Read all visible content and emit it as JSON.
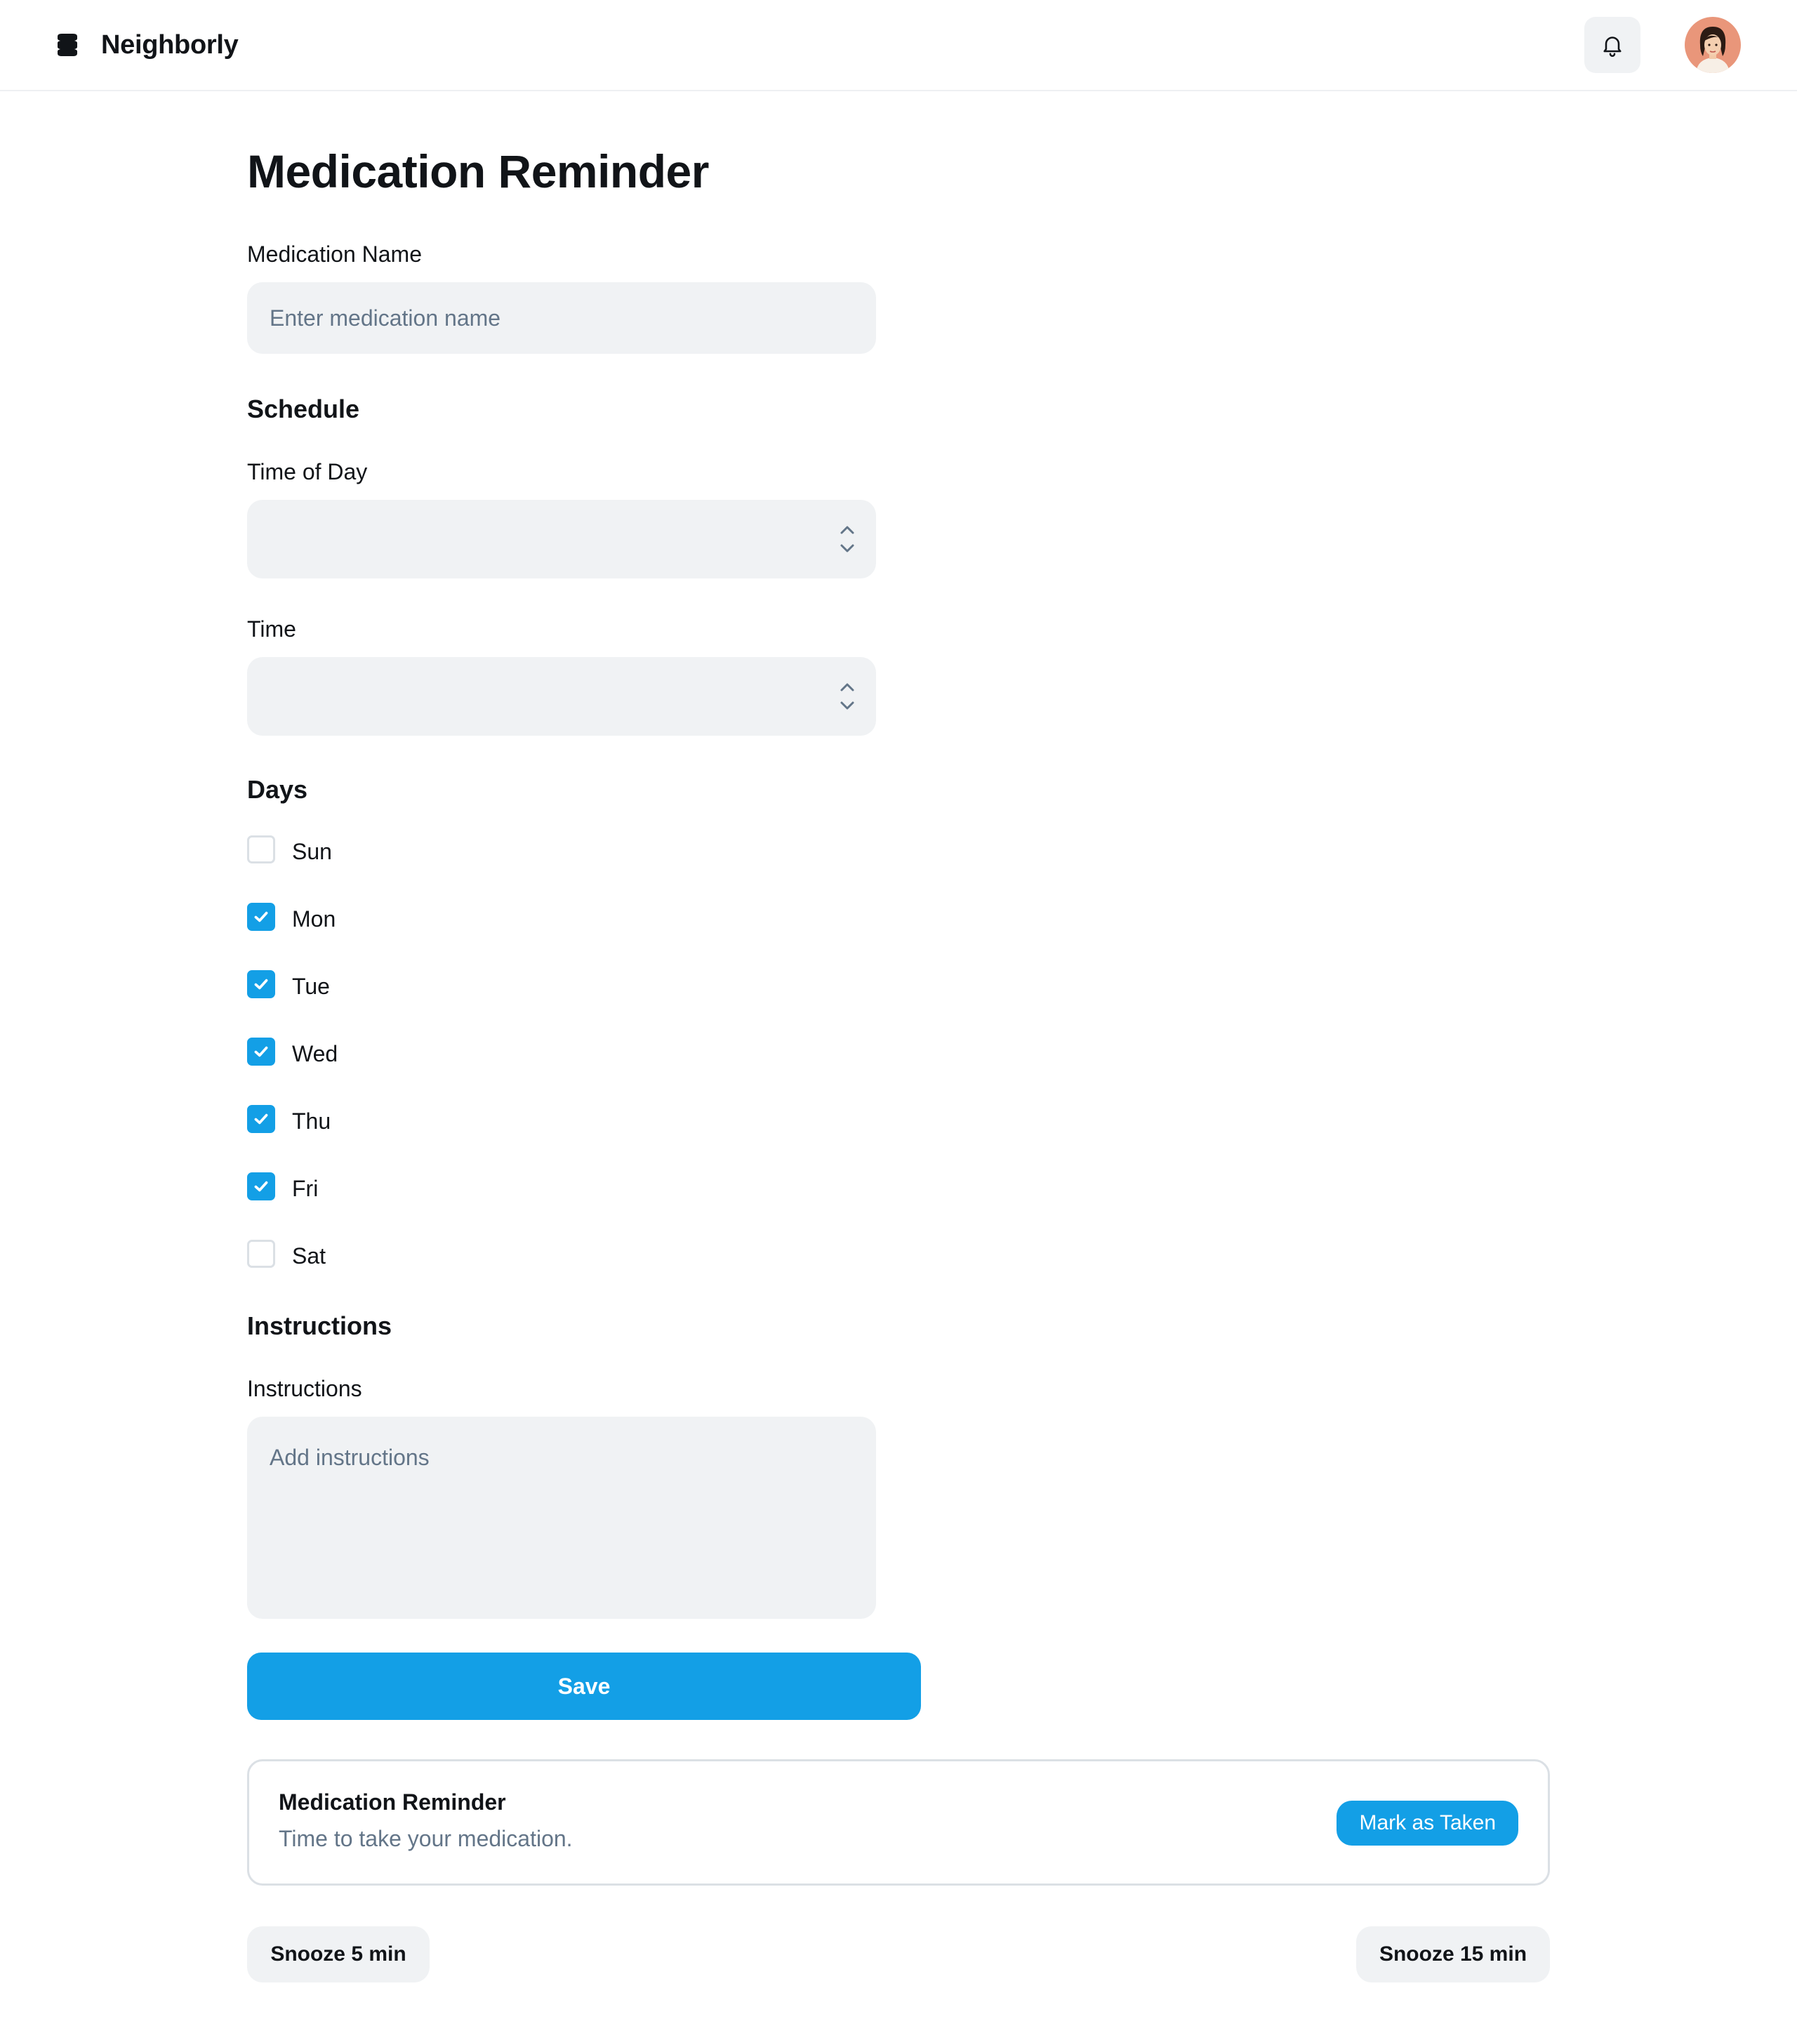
{
  "header": {
    "brand_name": "Neighborly",
    "icons": [
      "logo-icon",
      "bell-icon",
      "avatar"
    ]
  },
  "page": {
    "title": "Medication Reminder"
  },
  "form": {
    "medication_name": {
      "label": "Medication Name",
      "value": "",
      "placeholder": "Enter medication name"
    },
    "schedule_heading": "Schedule",
    "time_of_day": {
      "label": "Time of Day",
      "value": ""
    },
    "time": {
      "label": "Time",
      "value": ""
    },
    "days_heading": "Days",
    "days": [
      {
        "label": "Sun",
        "checked": false
      },
      {
        "label": "Mon",
        "checked": true
      },
      {
        "label": "Tue",
        "checked": true
      },
      {
        "label": "Wed",
        "checked": true
      },
      {
        "label": "Thu",
        "checked": true
      },
      {
        "label": "Fri",
        "checked": true
      },
      {
        "label": "Sat",
        "checked": false
      }
    ],
    "instructions_heading": "Instructions",
    "instructions": {
      "label": "Instructions",
      "value": "",
      "placeholder": "Add instructions"
    },
    "save_label": "Save"
  },
  "reminder_card": {
    "title": "Medication Reminder",
    "text": "Time to take your medication.",
    "mark_label": "Mark as Taken"
  },
  "snooze": {
    "short_label": "Snooze 5 min",
    "long_label": "Snooze 15 min"
  },
  "colors": {
    "accent": "#139fe6",
    "input_bg": "#f0f2f4",
    "muted_text": "#637588",
    "border": "#dbe0e5"
  }
}
